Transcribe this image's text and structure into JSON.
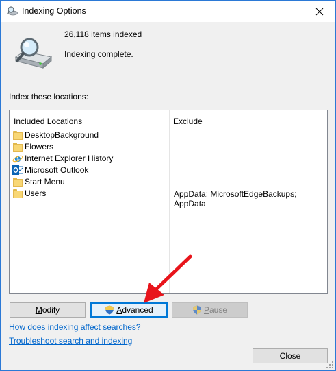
{
  "window": {
    "title": "Indexing Options"
  },
  "status": {
    "count": "26,118 items indexed",
    "state": "Indexing complete."
  },
  "locations": {
    "label": "Index these locations:",
    "header_included": "Included Locations",
    "header_exclude": "Exclude",
    "rows": [
      {
        "name": "DesktopBackground",
        "icon": "folder-icon",
        "exclude": ""
      },
      {
        "name": "Flowers",
        "icon": "folder-icon",
        "exclude": ""
      },
      {
        "name": "Internet Explorer History",
        "icon": "internet-explorer-icon",
        "exclude": ""
      },
      {
        "name": "Microsoft Outlook",
        "icon": "outlook-icon",
        "exclude": ""
      },
      {
        "name": "Start Menu",
        "icon": "folder-icon",
        "exclude": ""
      },
      {
        "name": "Users",
        "icon": "folder-icon",
        "exclude": "AppData; MicrosoftEdgeBackups; AppData"
      }
    ]
  },
  "buttons": {
    "modify_pre": "",
    "modify_u": "M",
    "modify_post": "odify",
    "advanced_pre": "",
    "advanced_u": "A",
    "advanced_post": "dvanced",
    "pause_pre": "",
    "pause_u": "P",
    "pause_post": "ause",
    "close": "Close"
  },
  "links": {
    "help": "How does indexing affect searches?",
    "troubleshoot": "Troubleshoot search and indexing"
  },
  "colors": {
    "accent": "#0078d7",
    "link": "#0066cc",
    "annotation_arrow": "#e8141b",
    "folder": "#f8d775"
  }
}
